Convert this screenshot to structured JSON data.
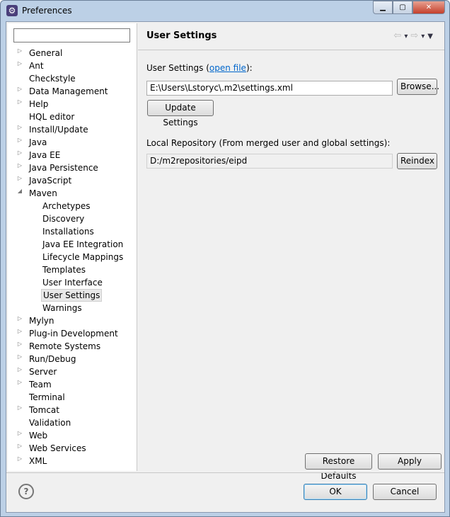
{
  "window": {
    "title": "Preferences",
    "icon": "eclipse-gear-icon"
  },
  "filter": {
    "value": ""
  },
  "tree": [
    {
      "label": "General",
      "arrow": true,
      "level": 0
    },
    {
      "label": "Ant",
      "arrow": true,
      "level": 0
    },
    {
      "label": "Checkstyle",
      "arrow": false,
      "level": 0
    },
    {
      "label": "Data Management",
      "arrow": true,
      "level": 0
    },
    {
      "label": "Help",
      "arrow": true,
      "level": 0
    },
    {
      "label": "HQL editor",
      "arrow": false,
      "level": 0
    },
    {
      "label": "Install/Update",
      "arrow": true,
      "level": 0
    },
    {
      "label": "Java",
      "arrow": true,
      "level": 0
    },
    {
      "label": "Java EE",
      "arrow": true,
      "level": 0
    },
    {
      "label": "Java Persistence",
      "arrow": true,
      "level": 0
    },
    {
      "label": "JavaScript",
      "arrow": true,
      "level": 0
    },
    {
      "label": "Maven",
      "arrow": true,
      "expanded": true,
      "level": 0
    },
    {
      "label": "Archetypes",
      "level": 1
    },
    {
      "label": "Discovery",
      "level": 1
    },
    {
      "label": "Installations",
      "level": 1
    },
    {
      "label": "Java EE Integration",
      "level": 1
    },
    {
      "label": "Lifecycle Mappings",
      "level": 1
    },
    {
      "label": "Templates",
      "level": 1
    },
    {
      "label": "User Interface",
      "level": 1
    },
    {
      "label": "User Settings",
      "level": 1,
      "selected": true
    },
    {
      "label": "Warnings",
      "level": 1
    },
    {
      "label": "Mylyn",
      "arrow": true,
      "level": 0
    },
    {
      "label": "Plug-in Development",
      "arrow": true,
      "level": 0
    },
    {
      "label": "Remote Systems",
      "arrow": true,
      "level": 0
    },
    {
      "label": "Run/Debug",
      "arrow": true,
      "level": 0
    },
    {
      "label": "Server",
      "arrow": true,
      "level": 0
    },
    {
      "label": "Team",
      "arrow": true,
      "level": 0
    },
    {
      "label": "Terminal",
      "arrow": false,
      "level": 0
    },
    {
      "label": "Tomcat",
      "arrow": true,
      "level": 0
    },
    {
      "label": "Validation",
      "arrow": false,
      "level": 0
    },
    {
      "label": "Web",
      "arrow": true,
      "level": 0
    },
    {
      "label": "Web Services",
      "arrow": true,
      "level": 0
    },
    {
      "label": "XML",
      "arrow": true,
      "level": 0
    }
  ],
  "page": {
    "title": "User Settings",
    "user_settings_label_pre": "User Settings (",
    "open_file_link": "open file",
    "user_settings_label_post": "):",
    "user_settings_value": "E:\\Users\\Lstoryc\\.m2\\settings.xml",
    "browse": "Browse...",
    "update": "Update Settings",
    "local_repo_label": "Local Repository (From merged user and global settings):",
    "local_repo_value": "D:/m2repositories/eipd",
    "reindex": "Reindex",
    "restore": "Restore Defaults",
    "apply": "Apply"
  },
  "footer": {
    "ok": "OK",
    "cancel": "Cancel"
  }
}
